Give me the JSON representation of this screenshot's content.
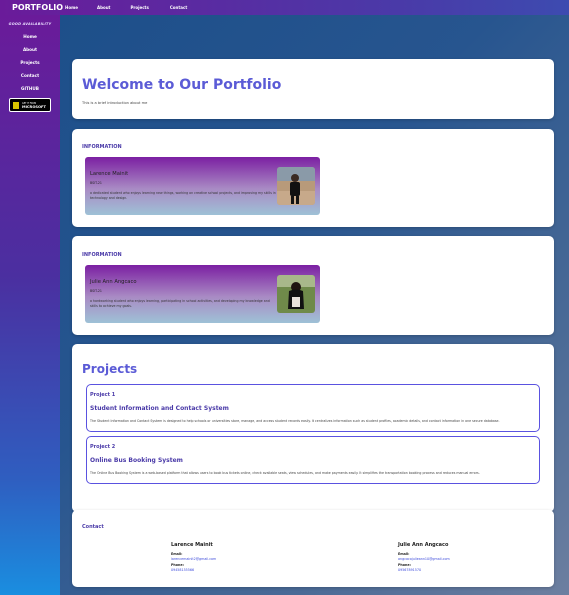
{
  "brand": "PORTFOLIO",
  "topnav": [
    "Home",
    "About",
    "Projects",
    "Contact"
  ],
  "sidebar": {
    "title": "GOOD AVAILABILITY",
    "items": [
      "Home",
      "About",
      "Projects",
      "Contact",
      "GITHUB"
    ],
    "badge_line1": "GET IT FROM",
    "badge_line2": "MICROSOFT"
  },
  "welcome": {
    "title": "Welcome to Our Portfolio",
    "intro": "This is a brief introduction about me"
  },
  "info1": {
    "label": "INFORMATION",
    "name": "Larence Mainit",
    "section": "BSIT-21",
    "desc": "a dedicated student who enjoys learning new things, working on creative school projects, and improving my skills in technology and design."
  },
  "info2": {
    "label": "INFORMATION",
    "name": "Julie Ann Angcaco",
    "section": "BSIT-21",
    "desc": "a hardworking student who enjoys learning, participating in school activities, and developing my knowledge and skills to achieve my goals."
  },
  "projects": {
    "title": "Projects",
    "items": [
      {
        "num": "Project 1",
        "title": "Student Information and Contact System",
        "desc": "The Student Information and Contact System is designed to help schools or universities store, manage, and access student records easily. It centralizes information such as student profiles, academic details, and contact information in one secure database."
      },
      {
        "num": "Project 2",
        "title": "Online Bus Booking System",
        "desc": "The Online Bus Booking System is a web-based platform that allows users to book bus tickets online, check available seats, view schedules, and make payments easily. It simplifies the transportation booking process and reduces manual errors."
      }
    ]
  },
  "contact": {
    "label": "Contact",
    "people": [
      {
        "name": "Larence Mainit",
        "email_label": "Email:",
        "email": "larencemainit2@gmail.com",
        "phone_label": "Phone:",
        "phone": "09458155566"
      },
      {
        "name": "Julie Ann Angcaco",
        "email_label": "Email:",
        "email": "angcacojulieann10@gmail.com",
        "phone_label": "Phone:",
        "phone": "09567891570"
      }
    ]
  },
  "colors": {
    "accent": "#5b5bd6",
    "heading_dark": "#4a3aa8",
    "project_border": "#5a52e0"
  }
}
